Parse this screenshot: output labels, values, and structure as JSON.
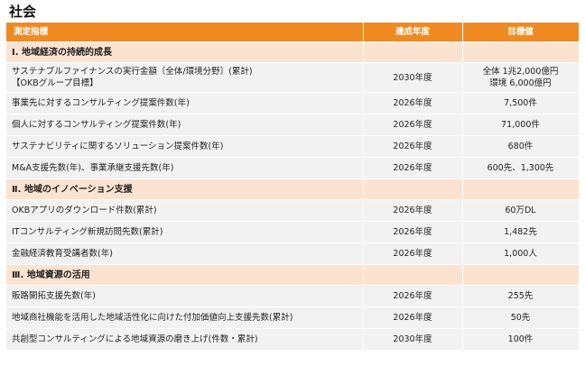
{
  "title": "社会",
  "headers": [
    "測定指標",
    "達成年度",
    "目標値"
  ],
  "sections": [
    {
      "heading": "Ⅰ. 地域経済の持続的成長",
      "rows": [
        {
          "name": "サステナブルファイナンスの実行金額〔全体/環境分野〕(累計)",
          "name2": "【OKBグループ目標】",
          "year": "2030年度",
          "target": "全体 1兆2,000億円",
          "target2": "環境 6,000億円"
        },
        {
          "name": "事業先に対するコンサルティング提案件数(年)",
          "year": "2026年度",
          "target": "7,500件"
        },
        {
          "name": "個人に対するコンサルティング提案件数(年)",
          "year": "2026年度",
          "target": "71,000件"
        },
        {
          "name": "サステナビリティに関するソリューション提案件数(年)",
          "year": "2026年度",
          "target": "680件"
        },
        {
          "name": "M&A支援先数(年)、事業承継支援先数(年)",
          "year": "2026年度",
          "target": "600先、1,300先"
        }
      ]
    },
    {
      "heading": "Ⅱ. 地域のイノベーション支援",
      "rows": [
        {
          "name": "OKBアプリのダウンロード件数(累計)",
          "year": "2026年度",
          "target": "60万DL"
        },
        {
          "name": "ITコンサルティング新規訪問先数(累計)",
          "year": "2026年度",
          "target": "1,482先"
        },
        {
          "name": "金融経済教育受講者数(年)",
          "year": "2026年度",
          "target": "1,000人"
        }
      ]
    },
    {
      "heading": "Ⅲ. 地域資源の活用",
      "rows": [
        {
          "name": "販路開拓支援先数(年)",
          "year": "2026年度",
          "target": "255先"
        },
        {
          "name": "地域商社機能を活用した地域活性化に向けた付加価値向上支援先数(累計)",
          "year": "2026年度",
          "target": "50先"
        },
        {
          "name": "共創型コンサルティングによる地域資源の磨き上げ(件数・累計)",
          "year": "2030年度",
          "target": "100件"
        }
      ]
    }
  ]
}
